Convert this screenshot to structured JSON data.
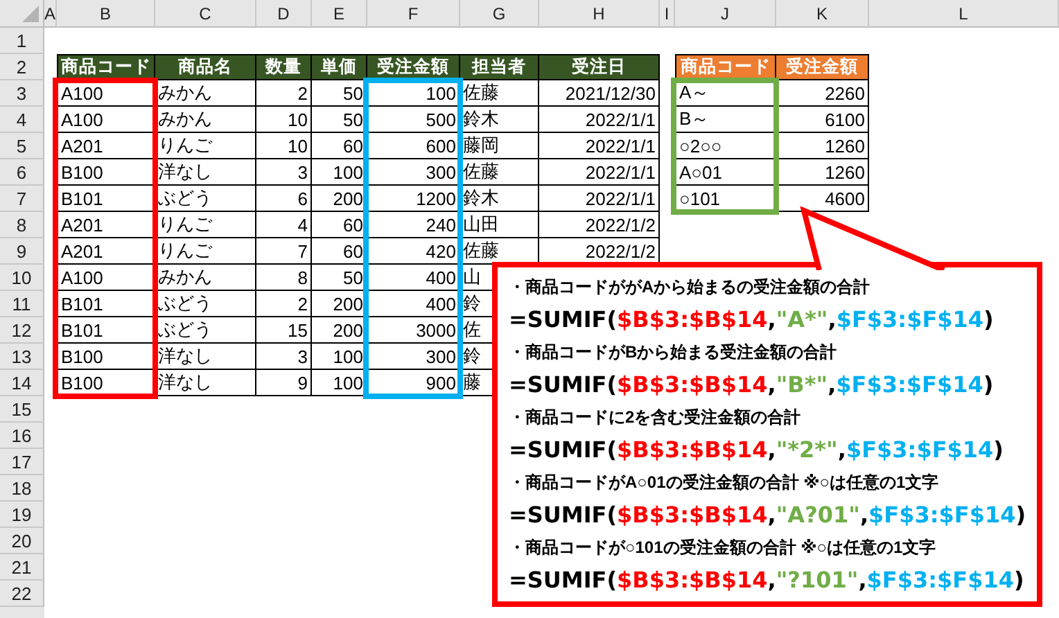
{
  "columns": [
    "A",
    "B",
    "C",
    "D",
    "E",
    "F",
    "G",
    "H",
    "I",
    "J",
    "K",
    "L"
  ],
  "row_numbers": [
    "1",
    "2",
    "3",
    "4",
    "5",
    "6",
    "7",
    "8",
    "9",
    "10",
    "11",
    "12",
    "13",
    "14",
    "15",
    "16",
    "17",
    "18",
    "19",
    "20",
    "21",
    "22"
  ],
  "table": {
    "headers": [
      "商品コード",
      "商品名",
      "数量",
      "単価",
      "受注金額",
      "担当者",
      "受注日"
    ],
    "rows": [
      {
        "code": "A100",
        "name": "みかん",
        "qty": "2",
        "price": "50",
        "amount": "100",
        "staff": "佐藤",
        "date": "2021/12/30"
      },
      {
        "code": "A100",
        "name": "みかん",
        "qty": "10",
        "price": "50",
        "amount": "500",
        "staff": "鈴木",
        "date": "2022/1/1"
      },
      {
        "code": "A201",
        "name": "りんご",
        "qty": "10",
        "price": "60",
        "amount": "600",
        "staff": "藤岡",
        "date": "2022/1/1"
      },
      {
        "code": "B100",
        "name": "洋なし",
        "qty": "3",
        "price": "100",
        "amount": "300",
        "staff": "佐藤",
        "date": "2022/1/1"
      },
      {
        "code": "B101",
        "name": "ぶどう",
        "qty": "6",
        "price": "200",
        "amount": "1200",
        "staff": "鈴木",
        "date": "2022/1/1"
      },
      {
        "code": "A201",
        "name": "りんご",
        "qty": "4",
        "price": "60",
        "amount": "240",
        "staff": "山田",
        "date": "2022/1/2"
      },
      {
        "code": "A201",
        "name": "りんご",
        "qty": "7",
        "price": "60",
        "amount": "420",
        "staff": "佐藤",
        "date": "2022/1/2"
      },
      {
        "code": "A100",
        "name": "みかん",
        "qty": "8",
        "price": "50",
        "amount": "400",
        "staff": "山"
      },
      {
        "code": "B101",
        "name": "ぶどう",
        "qty": "2",
        "price": "200",
        "amount": "400",
        "staff": "鈴"
      },
      {
        "code": "B101",
        "name": "ぶどう",
        "qty": "15",
        "price": "200",
        "amount": "3000",
        "staff": "佐"
      },
      {
        "code": "B100",
        "name": "洋なし",
        "qty": "3",
        "price": "100",
        "amount": "300",
        "staff": "鈴"
      },
      {
        "code": "B100",
        "name": "洋なし",
        "qty": "9",
        "price": "100",
        "amount": "900",
        "staff": "藤"
      }
    ]
  },
  "summary": {
    "headers": [
      "商品コード",
      "受注金額"
    ],
    "rows": [
      {
        "pattern": "A～",
        "total": "2260"
      },
      {
        "pattern": "B～",
        "total": "6100"
      },
      {
        "pattern": "○2○○",
        "total": "1260"
      },
      {
        "pattern": "A○01",
        "total": "1260"
      },
      {
        "pattern": "○101",
        "total": "4600"
      }
    ]
  },
  "callout": {
    "items": [
      {
        "caption": "・商品コードががAから始まるの受注金額の合計",
        "formula": [
          {
            "kind": "plain",
            "text": "=SUMIF("
          },
          {
            "kind": "range",
            "text": "$B$3:$B$14"
          },
          {
            "kind": "plain",
            "text": ","
          },
          {
            "kind": "criteria",
            "text": "\"A*\""
          },
          {
            "kind": "plain",
            "text": ","
          },
          {
            "kind": "sum_range",
            "text": "$F$3:$F$14"
          },
          {
            "kind": "plain",
            "text": ")"
          }
        ]
      },
      {
        "caption": "・商品コードがBから始まる受注金額の合計",
        "formula": [
          {
            "kind": "plain",
            "text": "=SUMIF("
          },
          {
            "kind": "range",
            "text": "$B$3:$B$14"
          },
          {
            "kind": "plain",
            "text": ","
          },
          {
            "kind": "criteria",
            "text": "\"B*\""
          },
          {
            "kind": "plain",
            "text": ","
          },
          {
            "kind": "sum_range",
            "text": "$F$3:$F$14"
          },
          {
            "kind": "plain",
            "text": ")"
          }
        ]
      },
      {
        "caption": "・商品コードに2を含む受注金額の合計",
        "formula": [
          {
            "kind": "plain",
            "text": "=SUMIF("
          },
          {
            "kind": "range",
            "text": "$B$3:$B$14"
          },
          {
            "kind": "plain",
            "text": ","
          },
          {
            "kind": "criteria",
            "text": "\"*2*\""
          },
          {
            "kind": "plain",
            "text": ","
          },
          {
            "kind": "sum_range",
            "text": "$F$3:$F$14"
          },
          {
            "kind": "plain",
            "text": ")"
          }
        ]
      },
      {
        "caption": "・商品コードがA○01の受注金額の合計 ※○は任意の1文字",
        "formula": [
          {
            "kind": "plain",
            "text": "=SUMIF("
          },
          {
            "kind": "range",
            "text": "$B$3:$B$14"
          },
          {
            "kind": "plain",
            "text": ","
          },
          {
            "kind": "criteria",
            "text": "\"A?01\""
          },
          {
            "kind": "plain",
            "text": ","
          },
          {
            "kind": "sum_range",
            "text": "$F$3:$F$14"
          },
          {
            "kind": "plain",
            "text": ")"
          }
        ]
      },
      {
        "caption": "・商品コードが○101の受注金額の合計 ※○は任意の1文字",
        "formula": [
          {
            "kind": "plain",
            "text": "=SUMIF("
          },
          {
            "kind": "range",
            "text": "$B$3:$B$14"
          },
          {
            "kind": "plain",
            "text": ","
          },
          {
            "kind": "criteria",
            "text": "\"?101\""
          },
          {
            "kind": "plain",
            "text": ","
          },
          {
            "kind": "sum_range",
            "text": "$F$3:$F$14"
          },
          {
            "kind": "plain",
            "text": ")"
          }
        ]
      }
    ]
  }
}
